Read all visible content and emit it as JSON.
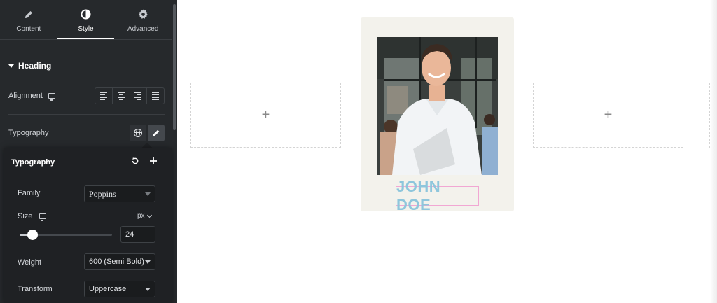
{
  "tabs": [
    {
      "label": "Content",
      "icon": "pencil-icon"
    },
    {
      "label": "Style",
      "icon": "contrast-icon"
    },
    {
      "label": "Advanced",
      "icon": "gear-icon"
    }
  ],
  "active_tab": "Style",
  "section": {
    "title": "Heading"
  },
  "alignment": {
    "label": "Alignment",
    "options": [
      "left",
      "center",
      "right",
      "justify"
    ]
  },
  "typography": {
    "label": "Typography"
  },
  "popover": {
    "title": "Typography",
    "family": {
      "label": "Family",
      "value": "Poppins"
    },
    "size": {
      "label": "Size",
      "unit": "px",
      "value": "24",
      "slider_fraction": 0.14
    },
    "weight": {
      "label": "Weight",
      "value": "600 (Semi Bold)"
    },
    "transform": {
      "label": "Transform",
      "value": "Uppercase"
    }
  },
  "canvas": {
    "add_symbol": "+",
    "card_name": "JOHN DOE",
    "colors": {
      "card_bg": "#f3f2ec",
      "name_text": "#8ec6dc",
      "selection_outline": "#f1a7d3"
    }
  }
}
